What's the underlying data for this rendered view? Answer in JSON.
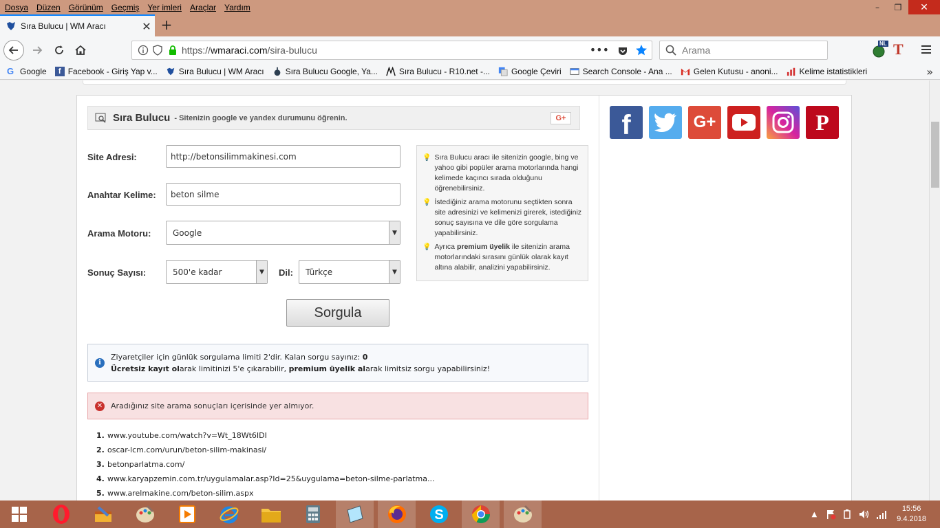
{
  "menu": [
    "Dosya",
    "Düzen",
    "Görünüm",
    "Geçmiş",
    "Yer imleri",
    "Araçlar",
    "Yardım"
  ],
  "window_controls": {
    "minimize": "–",
    "restore": "❐",
    "close": "✕"
  },
  "tab": {
    "title": "Sıra Bulucu | WM Aracı",
    "close": "✕",
    "new": "+"
  },
  "nav": {
    "url_prefix": "https://",
    "url_host": "wmaraci.com",
    "url_path": "/sira-bulucu",
    "search_placeholder": "Arama",
    "ext_nl": "NL",
    "ext_t": "T"
  },
  "bookmarks": [
    "Google",
    "Facebook - Giriş Yap v...",
    "Sıra Bulucu | WM Aracı",
    "Sıra Bulucu Google, Ya...",
    "Sıra Bulucu - R10.net -...",
    "Google Çeviri",
    "Search Console - Ana ...",
    "Gelen Kutusu - anoni...",
    "Kelime istatistikleri"
  ],
  "panel": {
    "title": "Sıra Bulucu",
    "subtitle": "- Sitenizin google ve yandex durumunu öğrenin.",
    "gplus": "G+"
  },
  "form": {
    "site_label": "Site Adresi:",
    "site_value": "http://betonsilimmakinesi.com",
    "keyword_label": "Anahtar Kelime:",
    "keyword_value": "beton silme",
    "engine_label": "Arama Motoru:",
    "engine_value": "Google",
    "count_label": "Sonuç Sayısı:",
    "count_value": "500'e kadar",
    "lang_label": "Dil:",
    "lang_value": "Türkçe",
    "submit": "Sorgula"
  },
  "tips": {
    "t1": "Sıra Bulucu aracı ile sitenizin google, bing ve yahoo gibi popüler arama motorlarında hangi kelimede kaçıncı sırada olduğunu öğrenebilirsiniz.",
    "t2": "İstediğiniz arama motorunu seçtikten sonra site adresinizi ve kelimenizi girerek, istediğiniz sonuç sayısına ve dile göre sorgulama yapabilirsiniz.",
    "t3_pre": "Ayrıca ",
    "t3_bold": "premium üyelik",
    "t3_post": " ile sitenizin arama motorlarındaki sırasını günlük olarak kayıt altına alabilir, analizini yapabilirsiniz."
  },
  "info": {
    "line1": "Ziyaretçiler için günlük sorgulama limiti 2'dir. Kalan sorgu sayınız: ",
    "remaining": "0",
    "l2_b1": "Ücretsiz kayıt ol",
    "l2_t1": "arak limitinizi 5'e çıkarabilir, ",
    "l2_b2": "premium üyelik al",
    "l2_t2": "arak limitsiz sorgu yapabilirsiniz!"
  },
  "error": "Aradığınız site arama sonuçları içerisinde yer almıyor.",
  "results": [
    {
      "n": "1.",
      "url": "www.youtube.com/watch?v=Wt_18Wt6IDI"
    },
    {
      "n": "2.",
      "url": "oscar-lcm.com/urun/beton-silim-makinasi/"
    },
    {
      "n": "3.",
      "url": "betonparlatma.com/"
    },
    {
      "n": "4.",
      "url": "www.karyapzemin.com.tr/uygulamalar.asp?Id=25&uygulama=beton-silme-parlatma..."
    },
    {
      "n": "5.",
      "url": "www.arelmakine.com/beton-silim.aspx"
    }
  ],
  "social": {
    "facebook": {
      "glyph": "f",
      "color": "#3b5998"
    },
    "twitter": {
      "color": "#55acee"
    },
    "googleplus": {
      "glyph": "G+",
      "color": "#dd4b39"
    },
    "youtube": {
      "color": "#cd201f"
    },
    "instagram": {
      "color": "#c13584"
    },
    "pinterest": {
      "glyph": "P",
      "color": "#bd081c"
    }
  },
  "clock": {
    "time": "15:56",
    "date": "9.4.2018"
  }
}
